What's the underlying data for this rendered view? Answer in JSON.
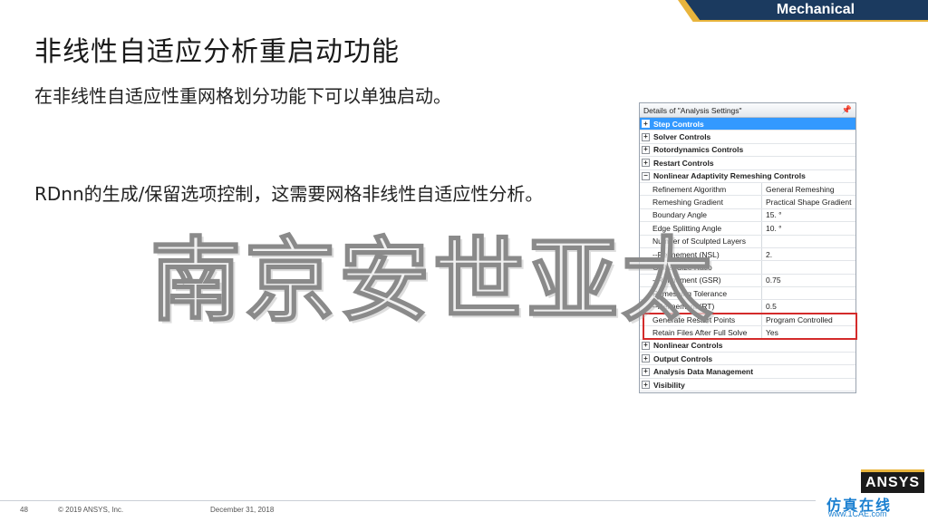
{
  "header": {
    "product": "Mechanical"
  },
  "slide": {
    "title": "非线性自适应分析重启动功能",
    "bullet1": "在非线性自适应性重网格划分功能下可以单独启动。",
    "bullet2": "RDnn的生成/保留选项控制，这需要网格非线性自适应性分析。"
  },
  "watermark": "南京安世亚太",
  "panel": {
    "title": "Details of \"Analysis Settings\"",
    "pin_glyph": "📌",
    "rows": [
      {
        "type": "group",
        "label": "Step Controls",
        "expander": "+",
        "selected": true
      },
      {
        "type": "group",
        "label": "Solver Controls",
        "expander": "+"
      },
      {
        "type": "group",
        "label": "Rotordynamics Controls",
        "expander": "+"
      },
      {
        "type": "group",
        "label": "Restart Controls",
        "expander": "+"
      },
      {
        "type": "group",
        "label": "Nonlinear Adaptivity Remeshing Controls",
        "expander": "−"
      },
      {
        "type": "prop",
        "name": "Refinement Algorithm",
        "value": "General Remeshing"
      },
      {
        "type": "prop",
        "name": "Remeshing Gradient",
        "value": "Practical Shape Gradient"
      },
      {
        "type": "prop",
        "name": "Boundary Angle",
        "value": "15. °"
      },
      {
        "type": "prop",
        "name": "Edge Splitting Angle",
        "value": "10. °"
      },
      {
        "type": "prop",
        "name": "Number of Sculpted Layers",
        "value": ""
      },
      {
        "type": "prop",
        "name": "--Refinement (NSL)",
        "value": "2."
      },
      {
        "type": "prop",
        "name": "Global Size Ratio",
        "value": ""
      },
      {
        "type": "prop",
        "name": "--Refinement (GSR)",
        "value": "0.75"
      },
      {
        "type": "prop",
        "name": "Remeshing Tolerance",
        "value": ""
      },
      {
        "type": "prop",
        "name": "--Refinement (RT)",
        "value": "0.5"
      },
      {
        "type": "prop",
        "name": "Generate Restart Points",
        "value": "Program Controlled"
      },
      {
        "type": "prop",
        "name": "Retain Files After Full Solve",
        "value": "Yes"
      },
      {
        "type": "group",
        "label": "Nonlinear Controls",
        "expander": "+"
      },
      {
        "type": "group",
        "label": "Output Controls",
        "expander": "+"
      },
      {
        "type": "group",
        "label": "Analysis Data Management",
        "expander": "+"
      },
      {
        "type": "group",
        "label": "Visibility",
        "expander": "+"
      }
    ]
  },
  "footer": {
    "page": "48",
    "copyright": "© 2019 ANSYS, Inc.",
    "date": "December 31, 2018",
    "logo": "ANSYS",
    "site_top": "仿真在线",
    "site_bottom": "www.1CAE.com"
  },
  "colors": {
    "banner_blue": "#1b3a5f",
    "banner_gold": "#e8b43c",
    "selection": "#3399ff",
    "highlight_box": "#d42b2b"
  }
}
